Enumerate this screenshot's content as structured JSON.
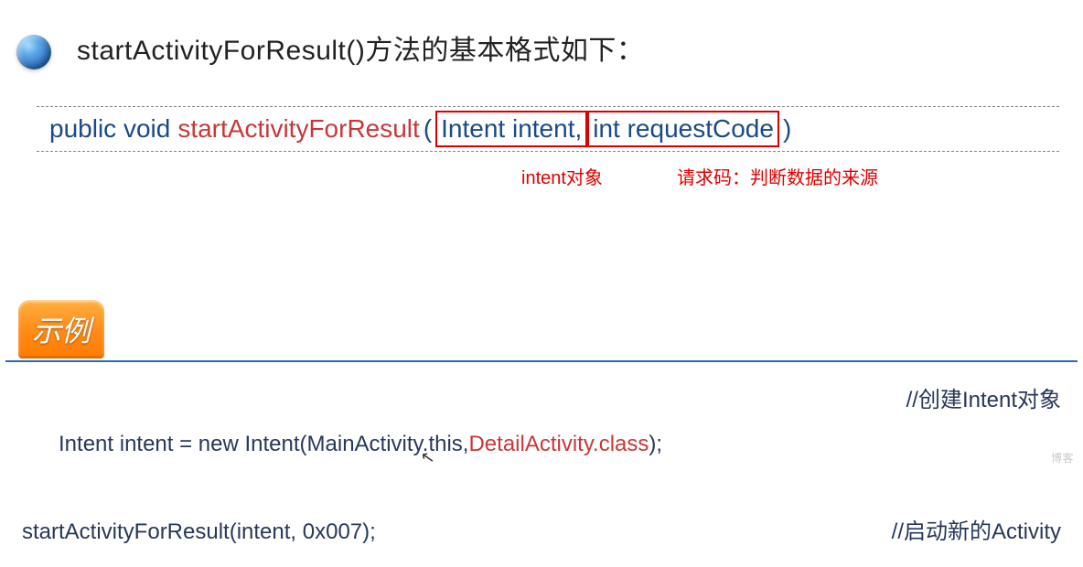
{
  "heading": "startActivityForResult()方法的基本格式如下：",
  "signature": {
    "modifiers": "public void",
    "method": "startActivityForResult",
    "open": "(",
    "param1": "Intent intent,",
    "param2": "int requestCode",
    "close": ")"
  },
  "annotations": {
    "param1": "intent对象",
    "param2": "请求码：判断数据的来源"
  },
  "example_label": "示例",
  "code": {
    "line1_left_a": "Intent intent = new Intent(MainActivity.this,",
    "line1_left_b": "DetailActivity.class",
    "line1_left_c": ");",
    "line1_comment": "//创建Intent对象",
    "line2_left": "startActivityForResult(intent, 0x007);",
    "line2_comment": "//启动新的Activity"
  },
  "watermark": "博客"
}
